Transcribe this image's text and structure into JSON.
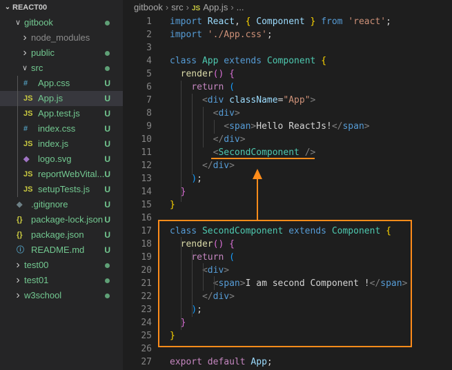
{
  "explorer": {
    "root": "REACT00",
    "items": [
      {
        "label": "gitbook",
        "kind": "folder-open",
        "indent": 0,
        "status": "dot"
      },
      {
        "label": "node_modules",
        "kind": "folder-closed",
        "indent": 1,
        "status": ""
      },
      {
        "label": "public",
        "kind": "folder-closed",
        "indent": 1,
        "status": "dot"
      },
      {
        "label": "src",
        "kind": "folder-open",
        "indent": 1,
        "status": "dot"
      },
      {
        "label": "App.css",
        "kind": "css",
        "indent": 2,
        "status": "U"
      },
      {
        "label": "App.js",
        "kind": "js",
        "indent": 2,
        "status": "U",
        "selected": true
      },
      {
        "label": "App.test.js",
        "kind": "js",
        "indent": 2,
        "status": "U"
      },
      {
        "label": "index.css",
        "kind": "css",
        "indent": 2,
        "status": "U"
      },
      {
        "label": "index.js",
        "kind": "js",
        "indent": 2,
        "status": "U"
      },
      {
        "label": "logo.svg",
        "kind": "svg",
        "indent": 2,
        "status": "U"
      },
      {
        "label": "reportWebVital...",
        "kind": "js",
        "indent": 2,
        "status": "U"
      },
      {
        "label": "setupTests.js",
        "kind": "js",
        "indent": 2,
        "status": "U"
      },
      {
        "label": ".gitignore",
        "kind": "git",
        "indent": 1,
        "status": "U"
      },
      {
        "label": "package-lock.json",
        "kind": "json",
        "indent": 1,
        "status": "U"
      },
      {
        "label": "package.json",
        "kind": "json",
        "indent": 1,
        "status": "U"
      },
      {
        "label": "README.md",
        "kind": "info",
        "indent": 1,
        "status": "U"
      },
      {
        "label": "test00",
        "kind": "folder-closed",
        "indent": 0,
        "status": "dot"
      },
      {
        "label": "test01",
        "kind": "folder-closed",
        "indent": 0,
        "status": "dot"
      },
      {
        "label": "w3school",
        "kind": "folder-closed",
        "indent": 0,
        "status": "dot"
      }
    ]
  },
  "breadcrumb": {
    "parts": [
      "gitbook",
      "src",
      "App.js",
      "..."
    ],
    "file_icon": "JS"
  },
  "editor": {
    "lines": [
      {
        "n": "1",
        "tokens": [
          [
            "kw",
            "import"
          ],
          [
            "txt",
            " "
          ],
          [
            "id",
            "React"
          ],
          [
            "txt",
            ", "
          ],
          [
            "br",
            "{"
          ],
          [
            "txt",
            " "
          ],
          [
            "id",
            "Component"
          ],
          [
            "txt",
            " "
          ],
          [
            "br",
            "}"
          ],
          [
            "txt",
            " "
          ],
          [
            "kw",
            "from"
          ],
          [
            "txt",
            " "
          ],
          [
            "str",
            "'react'"
          ],
          [
            "txt",
            ";"
          ]
        ]
      },
      {
        "n": "2",
        "tokens": [
          [
            "kw",
            "import"
          ],
          [
            "txt",
            " "
          ],
          [
            "str",
            "'./App.css'"
          ],
          [
            "txt",
            ";"
          ]
        ]
      },
      {
        "n": "3",
        "tokens": []
      },
      {
        "n": "4",
        "tokens": [
          [
            "kw",
            "class"
          ],
          [
            "txt",
            " "
          ],
          [
            "cls",
            "App"
          ],
          [
            "txt",
            " "
          ],
          [
            "kw",
            "extends"
          ],
          [
            "txt",
            " "
          ],
          [
            "cls",
            "Component"
          ],
          [
            "txt",
            " "
          ],
          [
            "br",
            "{"
          ]
        ]
      },
      {
        "n": "5",
        "tokens": [
          [
            "txt",
            "  "
          ],
          [
            "fn",
            "render"
          ],
          [
            "br2",
            "()"
          ],
          [
            "txt",
            " "
          ],
          [
            "br2",
            "{"
          ]
        ]
      },
      {
        "n": "6",
        "tokens": [
          [
            "txt",
            "    "
          ],
          [
            "ctl",
            "return"
          ],
          [
            "txt",
            " "
          ],
          [
            "br3",
            "("
          ]
        ]
      },
      {
        "n": "7",
        "tokens": [
          [
            "txt",
            "      "
          ],
          [
            "pun",
            "<"
          ],
          [
            "tag",
            "div"
          ],
          [
            "txt",
            " "
          ],
          [
            "attr",
            "className"
          ],
          [
            "txt",
            "="
          ],
          [
            "str",
            "\"App\""
          ],
          [
            "pun",
            ">"
          ]
        ]
      },
      {
        "n": "8",
        "tokens": [
          [
            "txt",
            "        "
          ],
          [
            "pun",
            "<"
          ],
          [
            "tag",
            "div"
          ],
          [
            "pun",
            ">"
          ]
        ]
      },
      {
        "n": "9",
        "tokens": [
          [
            "txt",
            "          "
          ],
          [
            "pun",
            "<"
          ],
          [
            "tag",
            "span"
          ],
          [
            "pun",
            ">"
          ],
          [
            "txt",
            "Hello ReactJs!"
          ],
          [
            "pun",
            "</"
          ],
          [
            "tag",
            "span"
          ],
          [
            "pun",
            ">"
          ]
        ]
      },
      {
        "n": "10",
        "tokens": [
          [
            "txt",
            "        "
          ],
          [
            "pun",
            "</"
          ],
          [
            "tag",
            "div"
          ],
          [
            "pun",
            ">"
          ]
        ]
      },
      {
        "n": "11",
        "tokens": [
          [
            "txt",
            "        "
          ],
          [
            "pun",
            "<"
          ],
          [
            "cls",
            "SecondComponent"
          ],
          [
            "txt",
            " "
          ],
          [
            "pun",
            "/>"
          ]
        ]
      },
      {
        "n": "12",
        "tokens": [
          [
            "txt",
            "      "
          ],
          [
            "pun",
            "</"
          ],
          [
            "tag",
            "div"
          ],
          [
            "pun",
            ">"
          ]
        ]
      },
      {
        "n": "13",
        "tokens": [
          [
            "txt",
            "    "
          ],
          [
            "br3",
            ")"
          ],
          [
            "txt",
            ";"
          ]
        ]
      },
      {
        "n": "14",
        "tokens": [
          [
            "txt",
            "  "
          ],
          [
            "br2",
            "}"
          ]
        ]
      },
      {
        "n": "15",
        "tokens": [
          [
            "br",
            "}"
          ]
        ]
      },
      {
        "n": "16",
        "tokens": []
      },
      {
        "n": "17",
        "tokens": [
          [
            "kw",
            "class"
          ],
          [
            "txt",
            " "
          ],
          [
            "cls",
            "SecondComponent"
          ],
          [
            "txt",
            " "
          ],
          [
            "kw",
            "extends"
          ],
          [
            "txt",
            " "
          ],
          [
            "cls",
            "Component"
          ],
          [
            "txt",
            " "
          ],
          [
            "br",
            "{"
          ]
        ]
      },
      {
        "n": "18",
        "tokens": [
          [
            "txt",
            "  "
          ],
          [
            "fn",
            "render"
          ],
          [
            "br2",
            "()"
          ],
          [
            "txt",
            " "
          ],
          [
            "br2",
            "{"
          ]
        ]
      },
      {
        "n": "19",
        "tokens": [
          [
            "txt",
            "    "
          ],
          [
            "ctl",
            "return"
          ],
          [
            "txt",
            " "
          ],
          [
            "br3",
            "("
          ]
        ]
      },
      {
        "n": "20",
        "tokens": [
          [
            "txt",
            "      "
          ],
          [
            "pun",
            "<"
          ],
          [
            "tag",
            "div"
          ],
          [
            "pun",
            ">"
          ]
        ]
      },
      {
        "n": "21",
        "tokens": [
          [
            "txt",
            "        "
          ],
          [
            "pun",
            "<"
          ],
          [
            "tag",
            "span"
          ],
          [
            "pun",
            ">"
          ],
          [
            "txt",
            "I am second Component !"
          ],
          [
            "pun",
            "</"
          ],
          [
            "tag",
            "span"
          ],
          [
            "pun",
            ">"
          ]
        ]
      },
      {
        "n": "22",
        "tokens": [
          [
            "txt",
            "      "
          ],
          [
            "pun",
            "</"
          ],
          [
            "tag",
            "div"
          ],
          [
            "pun",
            ">"
          ]
        ]
      },
      {
        "n": "23",
        "tokens": [
          [
            "txt",
            "    "
          ],
          [
            "br3",
            ")"
          ],
          [
            "txt",
            ";"
          ]
        ]
      },
      {
        "n": "24",
        "tokens": [
          [
            "txt",
            "  "
          ],
          [
            "br2",
            "}"
          ]
        ]
      },
      {
        "n": "25",
        "tokens": [
          [
            "br",
            "}"
          ]
        ]
      },
      {
        "n": "26",
        "tokens": []
      },
      {
        "n": "27",
        "tokens": [
          [
            "ctl",
            "export"
          ],
          [
            "txt",
            " "
          ],
          [
            "ctl",
            "default"
          ],
          [
            "txt",
            " "
          ],
          [
            "id",
            "App"
          ],
          [
            "txt",
            ";"
          ]
        ]
      }
    ]
  },
  "annotation": {
    "color": "#ff8c1a"
  },
  "colors": {
    "git_untracked": "#73c991",
    "js_icon": "#cbcb41",
    "css_icon": "#519aba",
    "json_icon": "#cbcb41",
    "svg_icon": "#a074c4"
  }
}
